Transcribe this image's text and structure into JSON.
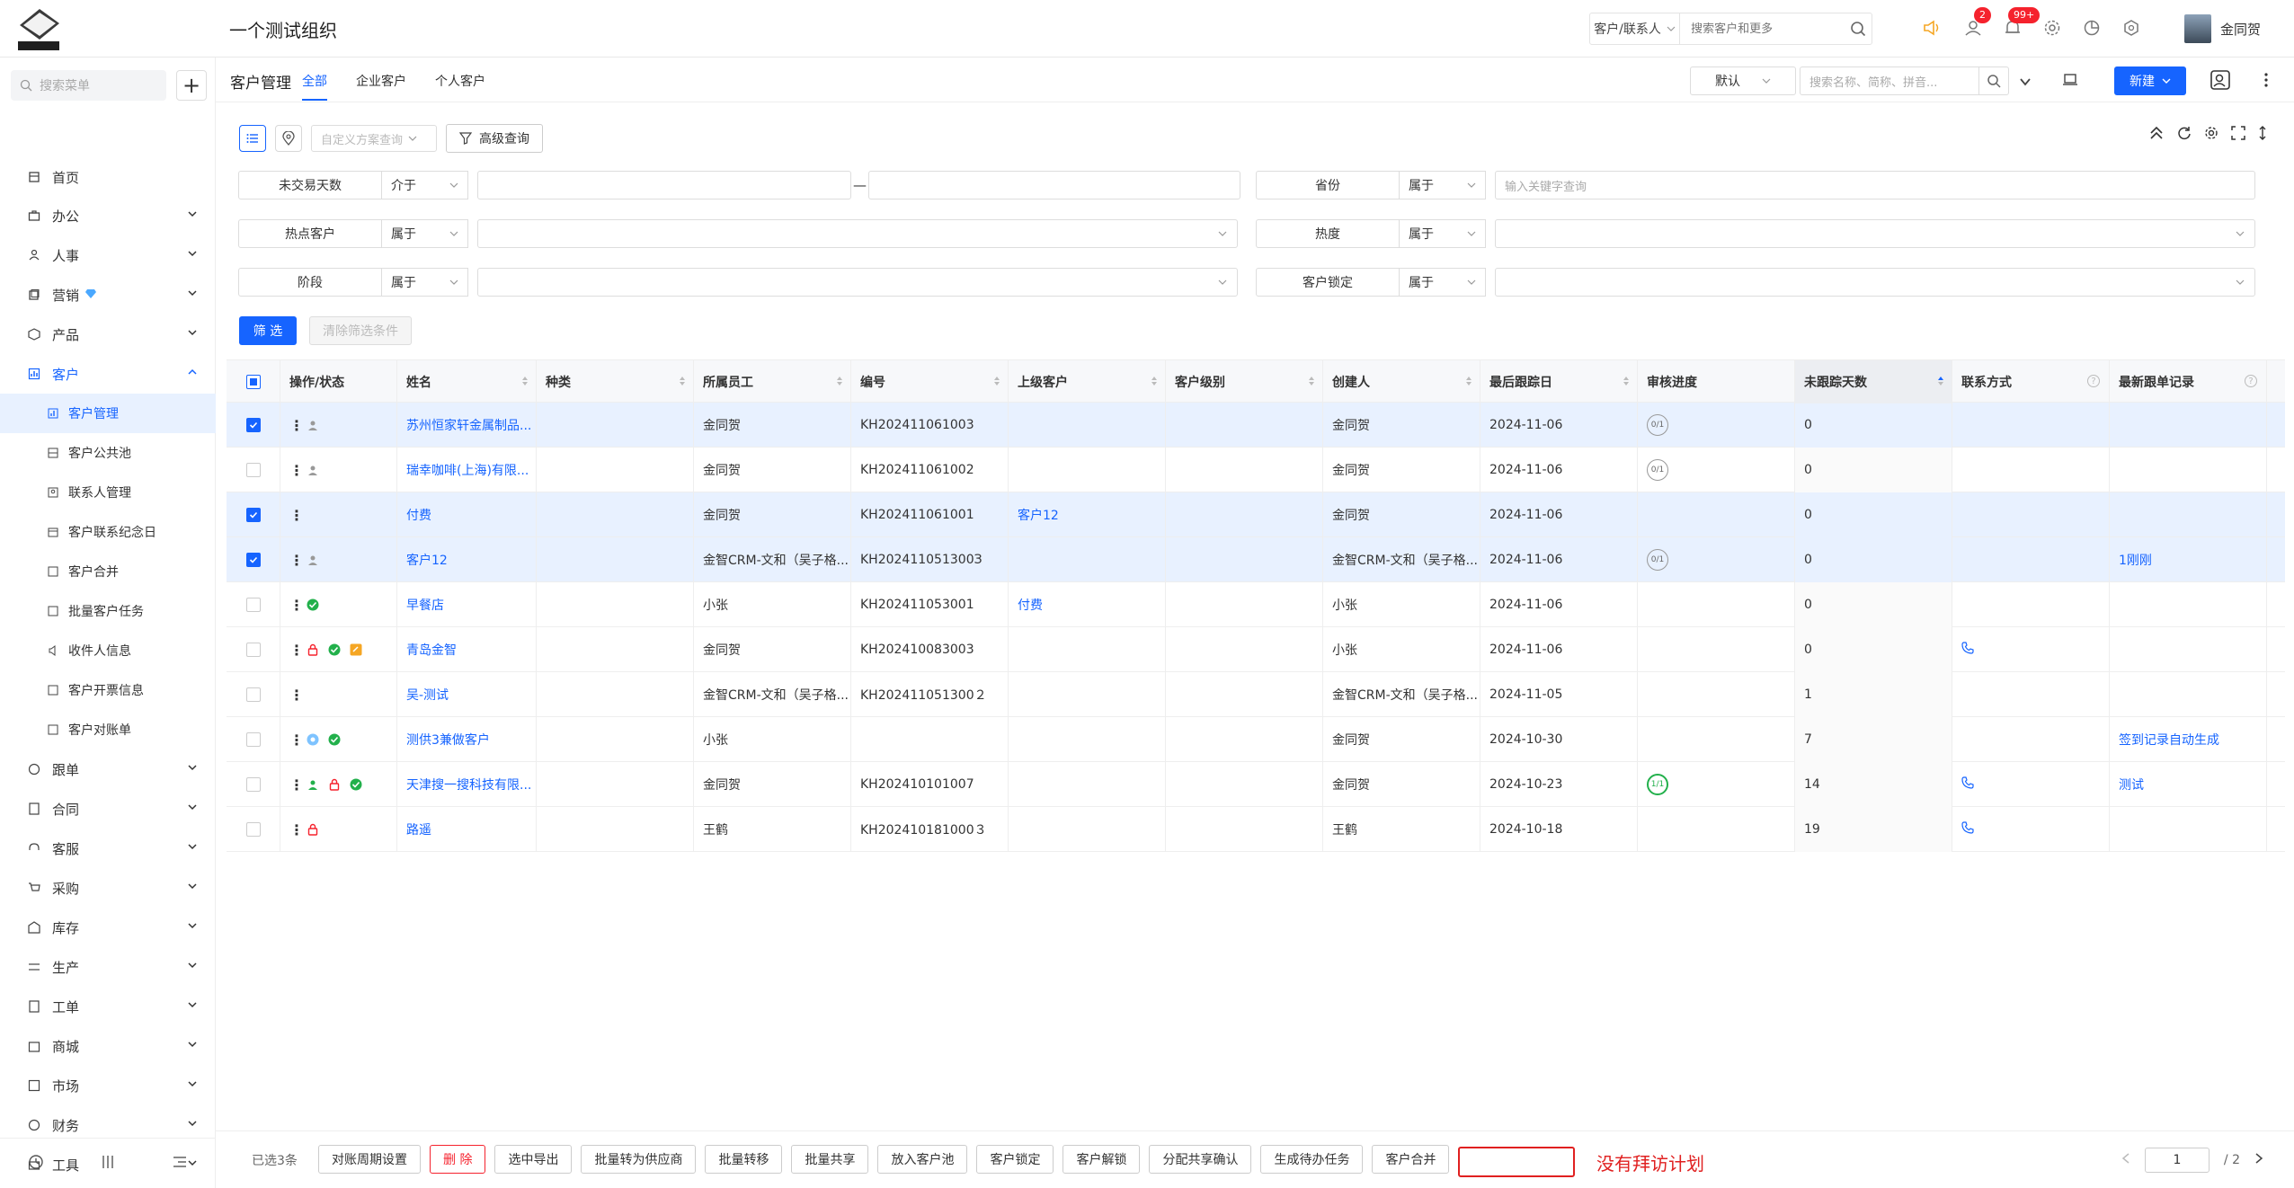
{
  "header": {
    "org_title": "一个测试组织",
    "search_type": "客户/联系人",
    "search_placeholder": "搜索客户和更多",
    "badge_messages": "2",
    "badge_notifications": "99+",
    "user_name": "金同贺"
  },
  "sidebar": {
    "search_placeholder": "搜索菜单",
    "items": [
      {
        "label": "首页",
        "icon": "home-icon"
      },
      {
        "label": "办公",
        "icon": "briefcase-icon"
      },
      {
        "label": "人事",
        "icon": "people-icon"
      },
      {
        "label": "营销",
        "icon": "marketing-icon"
      },
      {
        "label": "产品",
        "icon": "cube-icon"
      },
      {
        "label": "客户",
        "icon": "chart-icon"
      }
    ],
    "sub_items": [
      {
        "label": "客户管理"
      },
      {
        "label": "客户公共池"
      },
      {
        "label": "联系人管理"
      },
      {
        "label": "客户联系纪念日"
      },
      {
        "label": "客户合并"
      },
      {
        "label": "批量客户任务"
      },
      {
        "label": "收件人信息"
      },
      {
        "label": "客户开票信息"
      },
      {
        "label": "客户对账单"
      }
    ],
    "items_after": [
      {
        "label": "跟单"
      },
      {
        "label": "合同"
      },
      {
        "label": "客服"
      },
      {
        "label": "采购"
      },
      {
        "label": "库存"
      },
      {
        "label": "生产"
      },
      {
        "label": "工单"
      },
      {
        "label": "商城"
      },
      {
        "label": "市场"
      },
      {
        "label": "财务"
      },
      {
        "label": "工具"
      }
    ]
  },
  "main": {
    "page_title": "客户管理",
    "tabs": [
      "全部",
      "企业客户",
      "个人客户"
    ],
    "default_select": "默认",
    "keyword_placeholder": "搜索名称、简称、拼音...",
    "new_button": "新建",
    "scheme_placeholder": "自定义方案查询",
    "advanced_query": "高级查询",
    "filters": {
      "row1": {
        "label1": "未交易天数",
        "op1": "介于",
        "label2": "省份",
        "op2": "属于",
        "placeholder2": "输入关键字查询"
      },
      "row2": {
        "label1": "热点客户",
        "op1": "属于",
        "label2": "热度",
        "op2": "属于"
      },
      "row3": {
        "label1": "阶段",
        "op1": "属于",
        "label2": "客户锁定",
        "op2": "属于"
      }
    },
    "filter_button": "筛 选",
    "clear_button": "清除筛选条件"
  },
  "table": {
    "columns": [
      "操作/状态",
      "姓名",
      "种类",
      "所属员工",
      "编号",
      "上级客户",
      "客户级别",
      "创建人",
      "最后跟踪日",
      "审核进度",
      "未跟踪天数",
      "联系方式",
      "最新跟单记录"
    ],
    "rows": [
      {
        "name": "苏州恒家轩金属制品...",
        "employee": "金同贺",
        "code": "KH202411061003",
        "parent": "",
        "creator": "金同贺",
        "last_date": "2024-11-06",
        "audit": "0/1",
        "days": "0",
        "record": ""
      },
      {
        "name": "瑞幸咖啡(上海)有限...",
        "employee": "金同贺",
        "code": "KH202411061002",
        "parent": "",
        "creator": "金同贺",
        "last_date": "2024-11-06",
        "audit": "0/1",
        "days": "0",
        "record": ""
      },
      {
        "name": "付费",
        "employee": "金同贺",
        "code": "KH202411061001",
        "parent": "客户12",
        "creator": "金同贺",
        "last_date": "2024-11-06",
        "audit": "",
        "days": "0",
        "record": ""
      },
      {
        "name": "客户12",
        "employee": "金智CRM-文和（吴子格...",
        "code": "KH202411051300З",
        "parent": "",
        "creator": "金智CRM-文和（吴子格...",
        "last_date": "2024-11-06",
        "audit": "0/1",
        "days": "0",
        "record": "1刚刚"
      },
      {
        "name": "早餐店",
        "employee": "小张",
        "code": "KH202411053001",
        "parent": "付费",
        "creator": "小张",
        "last_date": "2024-11-06",
        "audit": "",
        "days": "0",
        "record": ""
      },
      {
        "name": "青岛金智",
        "employee": "金同贺",
        "code": "KH202410083003",
        "parent": "",
        "creator": "小张",
        "last_date": "2024-11-06",
        "audit": "",
        "days": "0",
        "record": ""
      },
      {
        "name": "吴-测试",
        "employee": "金智CRM-文和（吴子格...",
        "code": "KH202411051300２",
        "parent": "",
        "creator": "金智CRM-文和（吴子格...",
        "last_date": "2024-11-05",
        "audit": "",
        "days": "1",
        "record": ""
      },
      {
        "name": "测供3兼做客户",
        "employee": "小张",
        "code": "",
        "parent": "",
        "creator": "金同贺",
        "last_date": "2024-10-30",
        "audit": "",
        "days": "7",
        "record": "签到记录自动生成"
      },
      {
        "name": "天津搜一搜科技有限...",
        "employee": "金同贺",
        "code": "KH202410101007",
        "parent": "",
        "creator": "金同贺",
        "last_date": "2024-10-23",
        "audit": "1/1",
        "days": "14",
        "record": "测试"
      },
      {
        "name": "路遥",
        "employee": "王鹤",
        "code": "KH202410181000３",
        "parent": "",
        "creator": "王鹤",
        "last_date": "2024-10-18",
        "audit": "",
        "days": "19",
        "record": ""
      }
    ]
  },
  "bottom": {
    "selected_count": "已选3条",
    "buttons": [
      "对账周期设置",
      "删 除",
      "选中导出",
      "批量转为供应商",
      "批量转移",
      "批量共享",
      "放入客户池",
      "客户锁定",
      "客户解锁",
      "分配共享确认",
      "生成待办任务",
      "客户合并"
    ],
    "annotation": "没有拜访计划",
    "page_current": "1",
    "page_total": "/ 2"
  },
  "colors": {
    "accent": "#1664ff",
    "danger": "#f5222d",
    "annotation": "#e02020",
    "success": "#22b04b"
  }
}
